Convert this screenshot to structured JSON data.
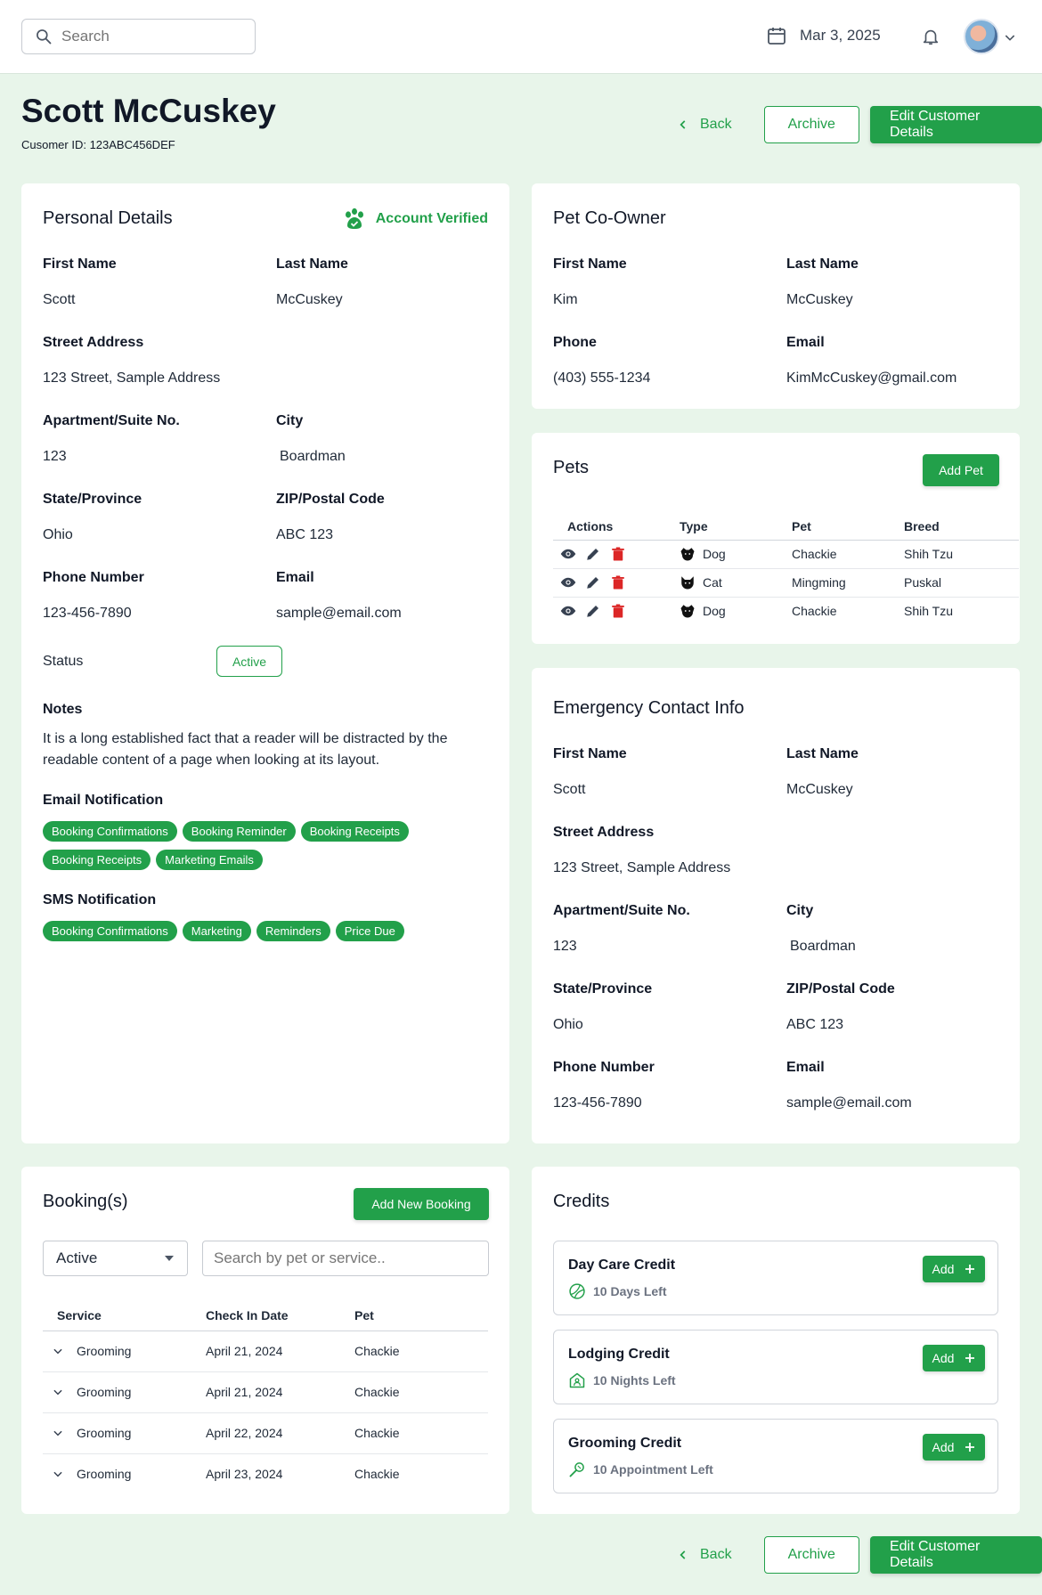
{
  "header": {
    "search_placeholder": "Search",
    "date": "Mar 3, 2025"
  },
  "page": {
    "title": "Scott McCuskey",
    "customer_id": "Cusomer ID: 123ABC456DEF",
    "back_label": "Back",
    "archive_label": "Archive",
    "edit_label": "Edit Customer Details"
  },
  "personal": {
    "heading": "Personal Details",
    "verified": "Account Verified",
    "first_name_label": "First Name",
    "first_name": "Scott",
    "last_name_label": "Last Name",
    "last_name": "McCuskey",
    "street_label": "Street Address",
    "street": "123 Street, Sample Address",
    "apt_label": "Apartment/Suite No.",
    "apt": "123",
    "city_label": "City",
    "city": "Boardman",
    "state_label": "State/Province",
    "state": "Ohio",
    "zip_label": "ZIP/Postal Code",
    "zip": "ABC 123",
    "phone_label": "Phone Number",
    "phone": "123-456-7890",
    "email_label": "Email",
    "email": "sample@email.com",
    "status_label": "Status",
    "status": "Active",
    "notes_label": "Notes",
    "notes": "It is a long established fact that a reader will be distracted by the readable content of a page when looking at its layout.",
    "email_notif_label": "Email Notification",
    "email_notifs": [
      "Booking Confirmations",
      "Booking Reminder",
      "Booking Receipts",
      "Booking Receipts",
      "Marketing Emails"
    ],
    "sms_notif_label": "SMS Notification",
    "sms_notifs": [
      "Booking Confirmations",
      "Marketing",
      "Reminders",
      "Price Due"
    ]
  },
  "coowner": {
    "heading": "Pet Co-Owner",
    "first_name_label": "First Name",
    "first_name": "Kim",
    "last_name_label": "Last Name",
    "last_name": "McCuskey",
    "phone_label": "Phone",
    "phone": "(403) 555-1234",
    "email_label": "Email",
    "email": "KimMcCuskey@gmail.com"
  },
  "pets": {
    "heading": "Pets",
    "add_label": "Add Pet",
    "columns": [
      "Actions",
      "Type",
      "Pet",
      "Breed"
    ],
    "rows": [
      {
        "type": "Dog",
        "pet": "Chackie",
        "breed": "Shih Tzu"
      },
      {
        "type": "Cat",
        "pet": "Mingming",
        "breed": "Puskal"
      },
      {
        "type": "Dog",
        "pet": "Chackie",
        "breed": "Shih Tzu"
      }
    ]
  },
  "emergency": {
    "heading": "Emergency Contact Info",
    "first_name_label": "First Name",
    "first_name": "Scott",
    "last_name_label": "Last Name",
    "last_name": "McCuskey",
    "street_label": "Street Address",
    "street": "123 Street, Sample Address",
    "apt_label": "Apartment/Suite No.",
    "apt": "123",
    "city_label": "City",
    "city": "Boardman",
    "state_label": "State/Province",
    "state": "Ohio",
    "zip_label": "ZIP/Postal Code",
    "zip": "ABC 123",
    "phone_label": "Phone Number",
    "phone": "123-456-7890",
    "email_label": "Email",
    "email": "sample@email.com"
  },
  "bookings": {
    "heading": "Booking(s)",
    "add_label": "Add New Booking",
    "filter_value": "Active",
    "search_placeholder": "Search by pet or service..",
    "columns": [
      "Service",
      "Check In Date",
      "Pet"
    ],
    "rows": [
      {
        "service": "Grooming",
        "date": "April 21, 2024",
        "pet": "Chackie"
      },
      {
        "service": "Grooming",
        "date": "April 21, 2024",
        "pet": "Chackie"
      },
      {
        "service": "Grooming",
        "date": "April 22, 2024",
        "pet": "Chackie"
      },
      {
        "service": "Grooming",
        "date": "April 23, 2024",
        "pet": "Chackie"
      }
    ]
  },
  "credits": {
    "heading": "Credits",
    "add_label": "Add",
    "items": [
      {
        "title": "Day Care  Credit",
        "sub": "10 Days Left",
        "icon": "daycare-icon"
      },
      {
        "title": "Lodging  Credit",
        "sub": "10 Nights Left",
        "icon": "lodging-icon"
      },
      {
        "title": "Grooming  Credit",
        "sub": "10 Appointment Left",
        "icon": "grooming-icon"
      }
    ]
  },
  "colors": {
    "accent": "#22a04a",
    "background": "#e8f5ea",
    "delete": "#dc2626"
  }
}
